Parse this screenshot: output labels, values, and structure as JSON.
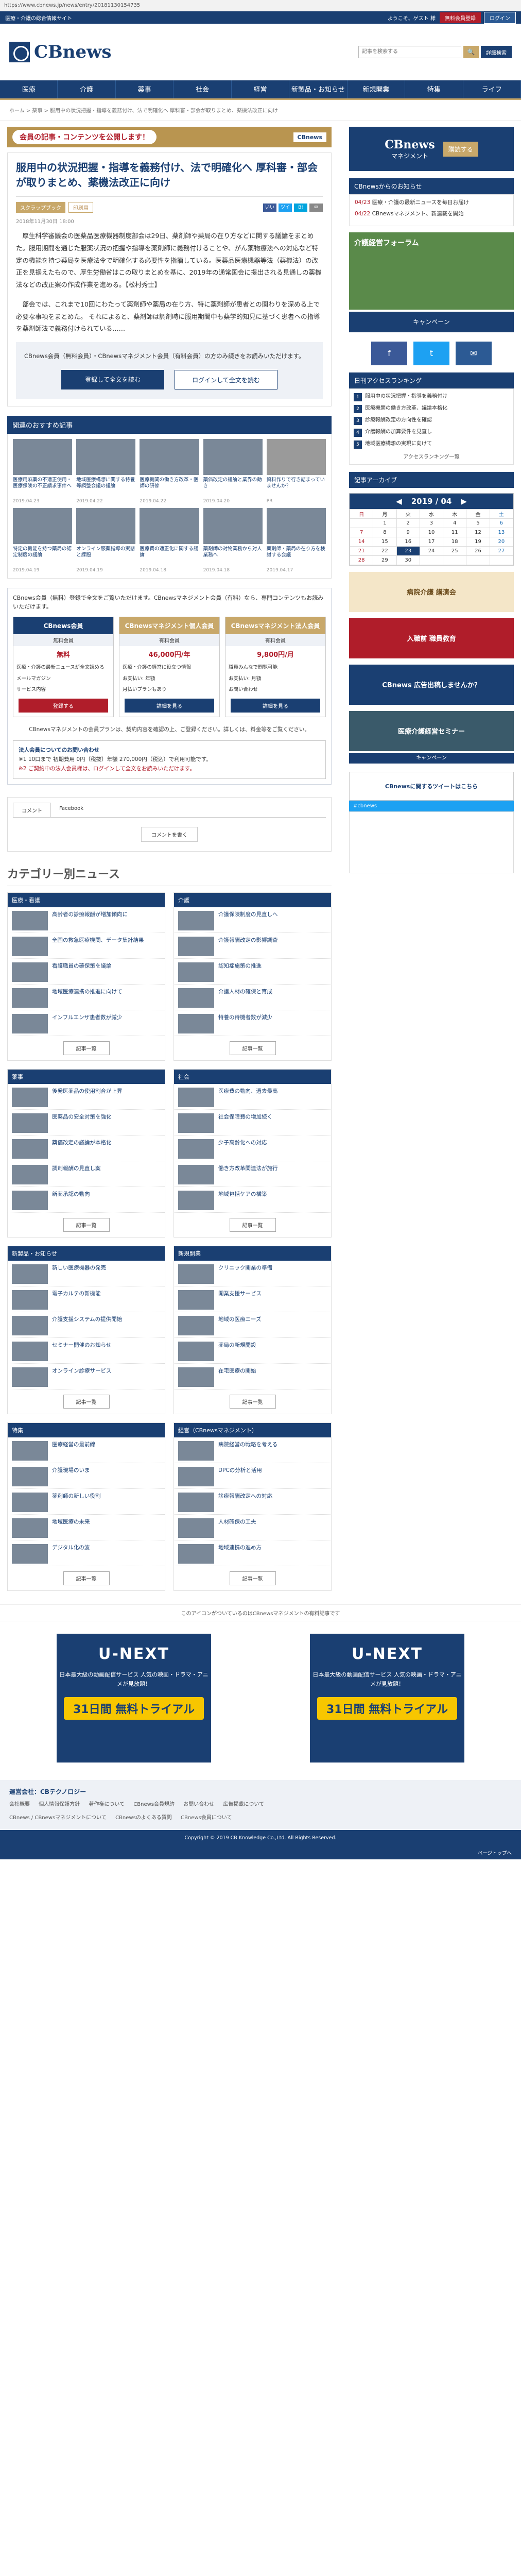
{
  "url": "https://www.cbnews.jp/news/entry/20181130154735",
  "topbar": {
    "left": "医療・介護の総合情報サイト",
    "welcome": "ようこそ、ゲスト 様",
    "register": "無料会員登録",
    "login": "ログイン"
  },
  "brand": {
    "logo": "CBnews"
  },
  "search": {
    "placeholder": "記事を検索する",
    "go": "🔍",
    "advanced": "詳細検索"
  },
  "nav": [
    "医療",
    "介護",
    "薬事",
    "社会",
    "経営",
    "新製品・お知らせ",
    "新規開業",
    "特集",
    "ライフ"
  ],
  "breadcrumb": "ホーム > 薬事 > 服用中の状況把握・指導を義務付け、法で明確化へ 厚科審・部会が取りまとめ、薬機法改正に向け",
  "promo": {
    "pill": "会員の記事・コンテンツを公開します！",
    "cbm": "CBnews"
  },
  "article": {
    "title": "服用中の状況把握・指導を義務付け、法で明確化へ 厚科審・部会が取りまとめ、薬機法改正に向け",
    "tag1": "スクラップブック",
    "tag2": "印刷用",
    "sns": [
      "いいね",
      "ツイート",
      "B!",
      "✉"
    ],
    "date": "2018年11月30日 18:00",
    "para1": "厚生科学審議会の医薬品医療機器制度部会は29日、薬剤師や薬局の在り方などに関する議論をまとめた。服用期間を通じた服薬状況の把握や指導を薬剤師に義務付けることや、がん薬物療法への対応など特定の機能を持つ薬局を医療法令で明確化する必要性を指摘している。医薬品医療機器等法（薬機法）の改正を見据えたもので、厚生労働省はこの取りまとめを基に、2019年の通常国会に提出される見通しの薬機法などの改正案の作成作業を進める。【松村秀士】",
    "para2": "部会では、これまで10回にわたって薬剤師や薬局の在り方、特に薬剤師が患者との関わりを深める上で必要な事項をまとめた。 それによると、薬剤師は調剤時に服用期間中も薬学的知見に基づく患者への指導を薬剤師法で義務付けられている……",
    "note": "CBnews会員（無料会員）・CBnewsマネジメント会員（有料会員）の方のみ続きをお読みいただけます。",
    "btn1": "登録して全文を読む",
    "btn2": "ログインして全文を読む"
  },
  "reco": {
    "heading": "関連のおすすめ記事",
    "items": [
      {
        "title": "医療用麻薬の不適正使用・医療保険の不正請求事件へ",
        "date": "2019.04.23"
      },
      {
        "title": "地域医療構想に関する特養等調整会議の議論",
        "date": "2019.04.22"
      },
      {
        "title": "医療機関の働き方改革・医師の研修",
        "date": "2019.04.22"
      },
      {
        "title": "薬価改定の議論と業界の動き",
        "date": "2019.04.20"
      },
      {
        "title": "資料作りで行き詰まっていませんか？",
        "date": "PR"
      },
      {
        "title": "特定の機能を持つ薬局の認定制度の議論",
        "date": "2019.04.19"
      },
      {
        "title": "オンライン服薬指導の実態と課題",
        "date": "2019.04.19"
      },
      {
        "title": "医療費の適正化に関する議論",
        "date": "2019.04.18"
      },
      {
        "title": "薬剤師の対物業務から対人業務へ",
        "date": "2019.04.18"
      },
      {
        "title": "薬剤師・薬局の在り方を検討する会議",
        "date": "2019.04.17"
      }
    ]
  },
  "info": {
    "head": "CBnews会員（無料）登録で全文をご覧いただけます。CBnewsマネジメント会員（有料）なら、専門コンテンツもお読みいただけます。",
    "plans": [
      {
        "name": "CBnews会員",
        "sub": "無料会員",
        "price": "無料",
        "rows": [
          "医療・介護の最新ニュースが全文読める",
          "メールマガジン",
          "サービス内容"
        ],
        "btn": "登録する"
      },
      {
        "name": "CBnewsマネジメント個人会員",
        "sub": "有料会員",
        "price": "46,000円/年",
        "rows": [
          "医療・介護の経営に役立つ情報",
          "お支払い: 年額",
          "月払いプランもあり"
        ],
        "btn": "詳細を見る"
      },
      {
        "name": "CBnewsマネジメント法人会員",
        "sub": "有料会員",
        "price": "9,800円/月",
        "rows": [
          "職員みんなで閲覧可能",
          "お支払い: 月額",
          "お問い合わせ"
        ],
        "btn": "詳細を見る"
      }
    ],
    "pnote": "CBnewsマネジメントの会員プランは、契約内容を確認の上、ご登録ください。詳しくは、料金等をご覧ください。",
    "corp_title": "法人会員についてのお問い合わせ",
    "corp_body": "※1 10口まで 初期費用 0円（税抜）年額 270,000円（税込）で利用可能です。",
    "corp_red": "※2 ご契約中の法人会員様は、ログインして全文をお読みいただけます。"
  },
  "comment": {
    "tab1": "コメント",
    "tab2": "Facebook",
    "btn": "コメントを書く"
  },
  "cats": {
    "title": "カテゴリー別ニュース",
    "groups": [
      {
        "name": "医療・看護",
        "items": [
          "高齢者の診療報酬が増加傾向に",
          "全国の救急医療機関、データ集計結果",
          "看護職員の確保策を議論",
          "地域医療連携の推進に向けて",
          "インフルエンザ患者数が減少"
        ]
      },
      {
        "name": "介護",
        "items": [
          "介護保険制度の見直しへ",
          "介護報酬改定の影響調査",
          "認知症施策の推進",
          "介護人材の確保と育成",
          "特養の待機者数が減少"
        ]
      },
      {
        "name": "薬事",
        "items": [
          "後発医薬品の使用割合が上昇",
          "医薬品の安全対策を強化",
          "薬価改定の議論が本格化",
          "調剤報酬の見直し案",
          "新薬承認の動向"
        ]
      },
      {
        "name": "社会",
        "items": [
          "医療費の動向、過去最高",
          "社会保障費の増加続く",
          "少子高齢化への対応",
          "働き方改革関連法が施行",
          "地域包括ケアの構築"
        ]
      },
      {
        "name": "新製品・お知らせ",
        "items": [
          "新しい医療機器の発売",
          "電子カルテの新機能",
          "介護支援システムの提供開始",
          "セミナー開催のお知らせ",
          "オンライン診療サービス"
        ]
      },
      {
        "name": "新規開業",
        "items": [
          "クリニック開業の準備",
          "開業支援サービス",
          "地域の医療ニーズ",
          "薬局の新規開設",
          "在宅医療の開始"
        ]
      },
      {
        "name": "特集",
        "items": [
          "医療経営の最前線",
          "介護現場のいま",
          "薬剤師の新しい役割",
          "地域医療の未来",
          "デジタル化の波"
        ]
      },
      {
        "name": "経営（CBnewsマネジメント）",
        "items": [
          "病院経営の戦略を考える",
          "DPCの分析と活用",
          "診療報酬改定への対応",
          "人材確保の工夫",
          "地域連携の進め方"
        ]
      }
    ],
    "more": "記事一覧"
  },
  "right": {
    "ad_title": "CBnews",
    "ad_sub": "マネジメント",
    "ad_btn": "購読する",
    "news_head": "CBnewsからのお知らせ",
    "news": [
      {
        "d": "04/23",
        "t": "医療・介護の最新ニュースを毎日お届け"
      },
      {
        "d": "04/22",
        "t": "CBnewsマネジメント、新連載を開始"
      }
    ],
    "frame1": "介護経営フォーラム",
    "frame1b": "キャンペーン",
    "social": [
      "f",
      "t",
      "✉"
    ],
    "rank_head": "日刊アクセスランキング",
    "rank": [
      "服用中の状況把握・指導を義務付け",
      "医療機関の働き方改革、議論本格化",
      "診療報酬改定の方向性を確認",
      "介護報酬の加算要件を見直し",
      "地域医療構想の実現に向けて"
    ],
    "rank_more": "アクセスランキング一覧",
    "cal_head": "記事アーカイブ",
    "cal_month": "2019 / 04",
    "cal_days": [
      "日",
      "月",
      "火",
      "水",
      "木",
      "金",
      "土"
    ],
    "blocks": [
      "病院介護 講演会",
      "入職前 職員教育",
      "CBnews 広告出稿しませんか？",
      "医療介護経営セミナー",
      "キャンペーン"
    ],
    "cbnx": "CBnewsに関するツイートはこちら",
    "tw": "#cbnews"
  },
  "bottom_note": "このアイコンがついているのはCBnewsマネジメントの有料記事です",
  "unext": {
    "logo": "U-NEXT",
    "sub": "日本最大級の動画配信サービス 人気の映画・ドラマ・アニメが見放題！",
    "days": "31日間 無料トライアル"
  },
  "footer": {
    "title": "運営会社：CBテクノロジー",
    "links": [
      "会社概要",
      "個人情報保護方針",
      "著作権について",
      "CBnews会員規約",
      "お問い合わせ",
      "広告掲載について"
    ],
    "links2": [
      "CBnews / CBnewsマネジメントについて",
      "CBnewsのよくある質問",
      "CBnews会員について"
    ]
  },
  "copyright": "Copyright © 2019 CB Knowledge Co.,Ltd. All Rights Reserved.",
  "pagetop": "ページトップへ"
}
